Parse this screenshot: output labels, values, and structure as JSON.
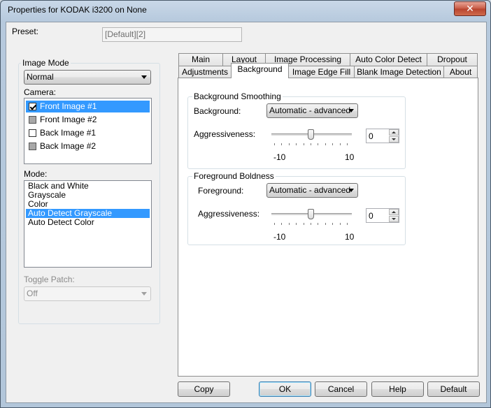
{
  "window": {
    "title": "Properties for KODAK i3200 on None",
    "close_label": "✕"
  },
  "preset": {
    "label": "Preset:",
    "value": "[Default][2]"
  },
  "image_mode": {
    "group_label": "Image Mode",
    "selected": "Normal",
    "camera_label": "Camera:",
    "cameras": [
      {
        "label": "Front Image #1",
        "state": "checked",
        "selected": true
      },
      {
        "label": "Front Image #2",
        "state": "gray",
        "selected": false
      },
      {
        "label": "Back Image #1",
        "state": "unchecked",
        "selected": false
      },
      {
        "label": "Back Image #2",
        "state": "gray",
        "selected": false
      }
    ],
    "mode_label": "Mode:",
    "modes": [
      {
        "label": "Black and White",
        "selected": false
      },
      {
        "label": "Grayscale",
        "selected": false
      },
      {
        "label": "Color",
        "selected": false
      },
      {
        "label": "Auto Detect Grayscale",
        "selected": true
      },
      {
        "label": "Auto Detect Color",
        "selected": false
      }
    ],
    "toggle_patch_label": "Toggle Patch:",
    "toggle_patch_value": "Off"
  },
  "tabs": {
    "row1": [
      "Main",
      "Layout",
      "Image Processing",
      "Auto Color Detect",
      "Dropout"
    ],
    "row2": [
      "Adjustments",
      "Background",
      "Image Edge Fill",
      "Blank Image Detection",
      "About"
    ],
    "active": "Background"
  },
  "background_smoothing": {
    "group_label": "Background Smoothing",
    "field_label": "Background:",
    "field_value": "Automatic - advanced",
    "aggr_label": "Aggressiveness:",
    "aggr_value": "0",
    "aggr_level": 0,
    "min_label": "-10",
    "max_label": "10"
  },
  "foreground_boldness": {
    "group_label": "Foreground Boldness",
    "field_label": "Foreground:",
    "field_value": "Automatic - advanced",
    "aggr_label": "Aggressiveness:",
    "aggr_value": "0",
    "aggr_level": 0,
    "min_label": "-10",
    "max_label": "10"
  },
  "buttons": {
    "copy": "Copy",
    "ok": "OK",
    "cancel": "Cancel",
    "help": "Help",
    "default": "Default"
  }
}
